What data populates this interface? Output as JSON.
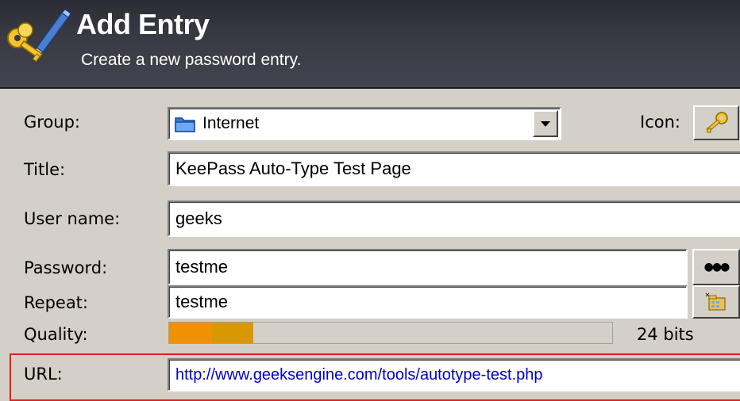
{
  "header": {
    "title": "Add Entry",
    "subtitle": "Create a new password entry.",
    "icon": "keys-pencil-icon"
  },
  "form": {
    "group": {
      "label": "Group:",
      "value": "Internet",
      "icon": "folder-icon"
    },
    "icon": {
      "label": "Icon:",
      "icon": "key-icon"
    },
    "title": {
      "label": "Title:",
      "value": "KeePass Auto-Type Test Page"
    },
    "username": {
      "label": "User name:",
      "value": "geeks"
    },
    "password": {
      "label": "Password:",
      "value": "testme",
      "toggle": "●●●"
    },
    "repeat": {
      "label": "Repeat:",
      "value": "testme",
      "generator_icon": "password-generator-icon"
    },
    "quality": {
      "label": "Quality:",
      "bits": "24 bits",
      "fill_percent": 19
    },
    "url": {
      "label": "URL:",
      "value": "http://www.geeksengine.com/tools/autotype-test.php"
    }
  },
  "colors": {
    "header_bg": "#3a3a44",
    "dialog_bg": "#d4d0c8",
    "quality_orange": "#f29100",
    "quality_amber": "#d99800",
    "url_text": "#0000cc",
    "highlight_red": "#e02020"
  }
}
